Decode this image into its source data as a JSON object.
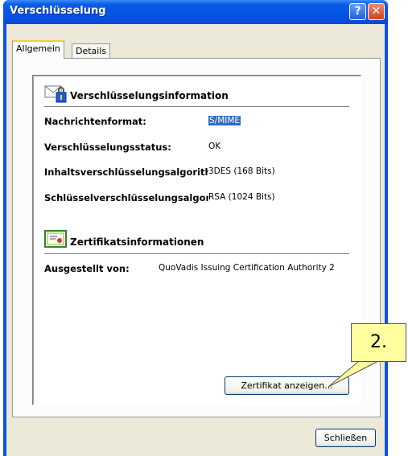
{
  "window": {
    "title": "Verschlüsselung",
    "help_glyph": "?",
    "close_glyph": "✕"
  },
  "tabs": [
    {
      "label": "Allgemein",
      "active": true
    },
    {
      "label": "Details",
      "active": false
    }
  ],
  "encryption_section": {
    "title": "Verschlüsselungsinformation",
    "icon": "envelope-lock-icon",
    "rows": [
      {
        "label": "Nachrichtenformat:",
        "value": "S/MIME"
      },
      {
        "label": "Verschlüsselungsstatus:",
        "value": "OK"
      },
      {
        "label": "Inhaltsverschlüsselungsalgorithmus:",
        "value": "3DES (168 Bits)"
      },
      {
        "label": "Schlüsselverschlüsselungsalgorithmus:",
        "value": "RSA (1024 Bits)"
      }
    ]
  },
  "certificate_section": {
    "title": "Zertifikatsinformationen",
    "icon": "certificate-icon",
    "rows": [
      {
        "label": "Ausgestellt von:",
        "value": "QuoVadis Issuing Certification Authority 2"
      }
    ]
  },
  "buttons": {
    "view_certificate": "Zertifikat anzeigen...",
    "close": "Schließen"
  },
  "callout": {
    "label": "2."
  },
  "colors": {
    "titlebar": "#0554e3",
    "dialog_bg": "#ece9d8",
    "selection": "#316ac5",
    "callout_bg": "#ffffa0"
  }
}
